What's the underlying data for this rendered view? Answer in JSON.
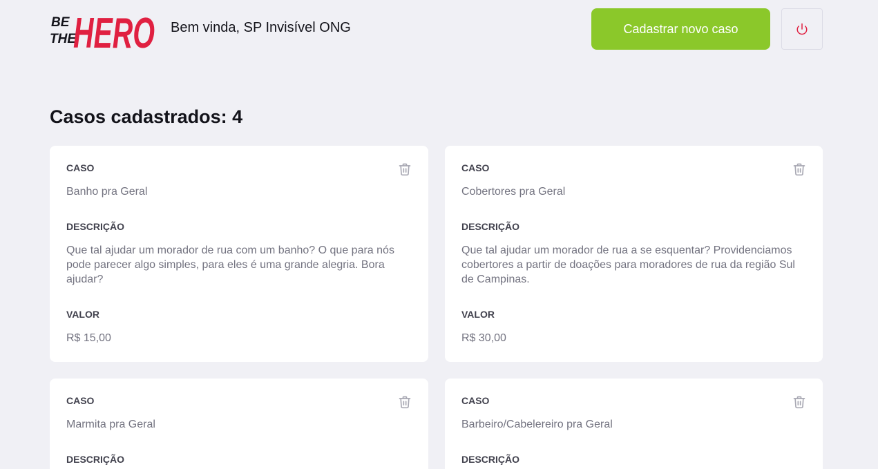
{
  "header": {
    "logo_text_small_1": "BE",
    "logo_text_small_2": "THE",
    "logo_text_big": "HERO",
    "welcome": "Bem vinda, SP Invisível ONG",
    "new_case_label": "Cadastrar novo caso",
    "logout_icon": "power-icon",
    "brand_color": "#e02041",
    "button_color": "#8bc82a"
  },
  "main": {
    "title": "Casos cadastrados: 4"
  },
  "labels": {
    "case": "CASO",
    "description": "DESCRIÇÃO",
    "value": "VALOR"
  },
  "cases": [
    {
      "title": "Banho pra Geral",
      "description": "Que tal ajudar um morador de rua com um banho? O que para nós pode parecer algo simples, para eles é uma grande alegria. Bora ajudar?",
      "value": "R$ 15,00"
    },
    {
      "title": "Cobertores pra Geral",
      "description": "Que tal ajudar um morador de rua a se esquentar? Providenciamos cobertores a partir de doações para moradores de rua da região Sul de Campinas.",
      "value": "R$ 30,00"
    },
    {
      "title": "Marmita pra Geral"
    },
    {
      "title": "Barbeiro/Cabelereiro pra Geral"
    }
  ]
}
